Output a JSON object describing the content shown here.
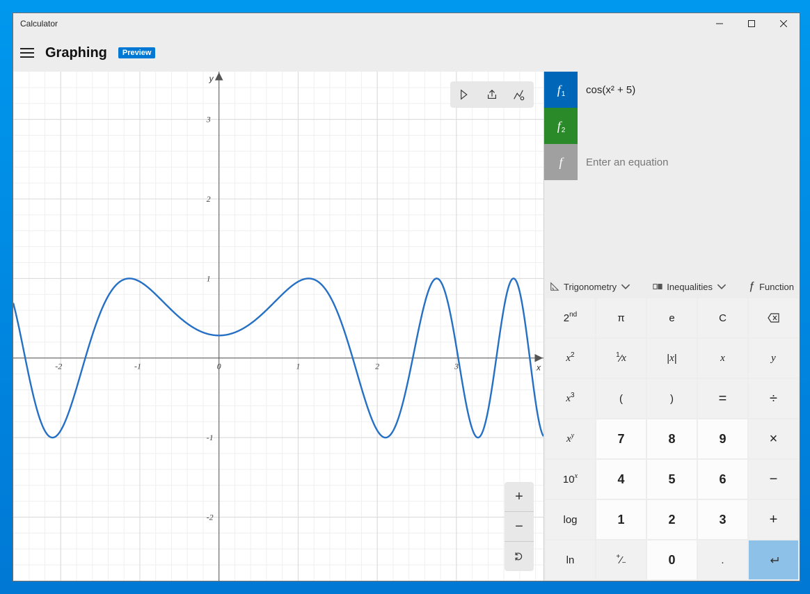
{
  "window": {
    "title": "Calculator"
  },
  "header": {
    "mode": "Graphing",
    "badge": "Preview"
  },
  "chart_data": {
    "type": "line",
    "title": "",
    "xlabel": "x",
    "ylabel": "y",
    "xlim": [
      -2.6,
      4.1
    ],
    "ylim": [
      -2.8,
      3.6
    ],
    "x_ticks": [
      -2,
      -1,
      0,
      1,
      2,
      3
    ],
    "y_ticks": [
      -2,
      -1,
      1,
      2,
      3
    ],
    "series": [
      {
        "name": "f1",
        "expression": "cos(x^2 + 5)",
        "color": "#2570c5"
      }
    ]
  },
  "equations": [
    {
      "chip": "f",
      "sub": "1",
      "color": "#0067b8",
      "expression": "cos(x² + 5)"
    },
    {
      "chip": "f",
      "sub": "2",
      "color": "#2a8a2a",
      "expression": ""
    },
    {
      "chip": "f",
      "sub": "",
      "color": "#a0a0a0",
      "placeholder": "Enter an equation",
      "expression": ""
    }
  ],
  "fn_tabs": {
    "trig": "Trigonometry",
    "ineq": "Inequalities",
    "func": "Function"
  },
  "keypad": [
    [
      "2nd",
      "π",
      "e",
      "C",
      "⌫"
    ],
    [
      "x²",
      "¹⁄x",
      "|x|",
      "x",
      "y"
    ],
    [
      "x³",
      "(",
      ")",
      "=",
      "÷"
    ],
    [
      "xʸ",
      "7",
      "8",
      "9",
      "×"
    ],
    [
      "10ˣ",
      "4",
      "5",
      "6",
      "−"
    ],
    [
      "log",
      "1",
      "2",
      "3",
      "+"
    ],
    [
      "ln",
      "⁺⁄₋",
      "0",
      ".",
      "↵"
    ]
  ],
  "keypad_styles": [
    [
      "",
      "",
      "",
      "",
      ""
    ],
    [
      "",
      "",
      "",
      "",
      ""
    ],
    [
      "",
      "",
      "",
      "op",
      "op"
    ],
    [
      "",
      "nm",
      "nm",
      "nm",
      "op"
    ],
    [
      "",
      "nm",
      "nm",
      "nm",
      "op"
    ],
    [
      "",
      "nm",
      "nm",
      "nm",
      "op"
    ],
    [
      "",
      "",
      "nm",
      "",
      "hl"
    ]
  ]
}
